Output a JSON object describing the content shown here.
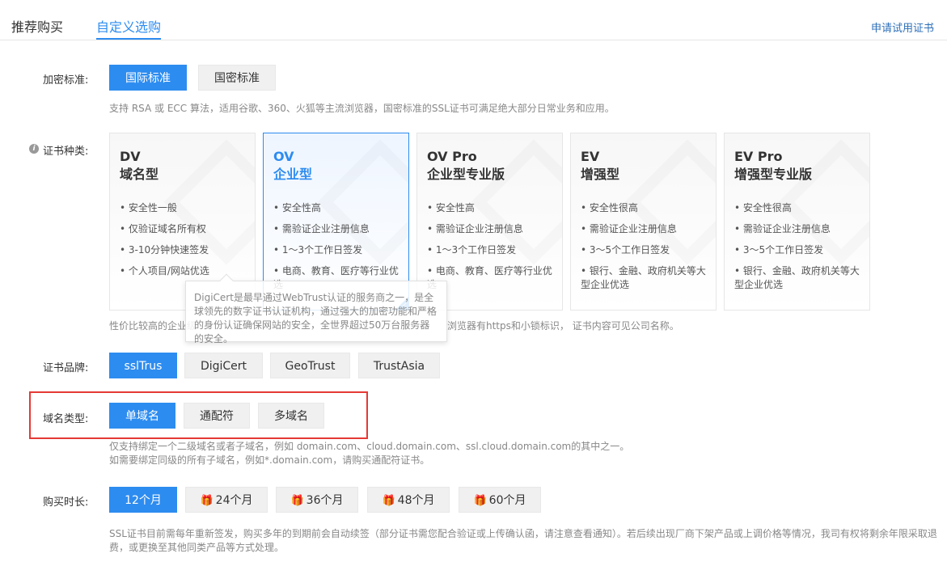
{
  "tabs": [
    {
      "label": "推荐购买"
    },
    {
      "label": "自定义选购"
    }
  ],
  "trial_link": "申请试用证书",
  "encryption": {
    "label": "加密标准:",
    "options": [
      "国际标准",
      "国密标准"
    ],
    "selected": "国际标准",
    "hint": "支持 RSA 或 ECC 算法，适用谷歌、360、火狐等主流浏览器，国密标准的SSL证书可满足绝大部分日常业务和应用。"
  },
  "cert_type": {
    "label": "证书种类:",
    "selected": "OV",
    "cards": [
      {
        "name": "DV",
        "subtitle": "域名型",
        "features": [
          "• 安全性一般",
          "• 仅验证域名所有权",
          "• 3-10分钟快速签发",
          "• 个人项目/网站优选"
        ]
      },
      {
        "name": "OV",
        "subtitle": "企业型",
        "features": [
          "• 安全性高",
          "• 需验证企业注册信息",
          "• 1～3个工作日签发",
          "• 电商、教育、医疗等行业优选"
        ]
      },
      {
        "name": "OV Pro",
        "subtitle": "企业型专业版",
        "features": [
          "• 安全性高",
          "• 需验证企业注册信息",
          "• 1～3个工作日签发",
          "• 电商、教育、医疗等行业优选"
        ]
      },
      {
        "name": "EV",
        "subtitle": "增强型",
        "features": [
          "• 安全性很高",
          "• 需验证企业注册信息",
          "• 3～5个工作日签发",
          "• 银行、金融、政府机关等大型企业优选"
        ]
      },
      {
        "name": "EV Pro",
        "subtitle": "增强型专业版",
        "features": [
          "• 安全性很高",
          "• 需验证企业注册信息",
          "• 3～5个工作日签发",
          "• 银行、金融、政府机关等大型企业优选"
        ]
      }
    ],
    "hint_left": "性价比较高的企业级",
    "hint_right": "浏览器有https和小锁标识， 证书内容可见公司名称。"
  },
  "tooltip": {
    "text": "DigiCert是最早通过WebTrust认证的服务商之一，是全球领先的数字证书认证机构，通过强大的加密功能和严格的身份认证确保网站的安全，全世界超过50万台服务器的安全。"
  },
  "brand": {
    "label": "证书品牌:",
    "options": [
      "sslTrus",
      "DigiCert",
      "GeoTrust",
      "TrustAsia"
    ],
    "selected": "sslTrus"
  },
  "domain_type": {
    "label": "域名类型:",
    "options": [
      "单域名",
      "通配符",
      "多域名"
    ],
    "selected": "单域名",
    "hint_line1": "仅支持绑定一个二级域名或者子域名，例如 domain.com、cloud.domain.com、ssl.cloud.domain.com的其中之一。",
    "hint_line2": "如需要绑定同级的所有子域名，例如*.domain.com，请购买通配符证书。"
  },
  "duration": {
    "label": "购买时长:",
    "options": [
      "12个月",
      "24个月",
      "36个月",
      "48个月",
      "60个月"
    ],
    "selected": "12个月",
    "gift_icon": "gift-icon",
    "hint_line1": "SSL证书目前需每年重新签发，购买多年的到期前会自动续签（部分证书需您配合验证或上传确认函，请注意查看通知）。若后续出现厂商下架产品或上调价格等情况，我司有权将剩余年限采取退",
    "hint_line2": "费，或更换至其他同类产品等方式处理。"
  },
  "colors": {
    "accent": "#2d8cf0",
    "highlight_border": "#e53935",
    "gift": "#f5a623"
  }
}
